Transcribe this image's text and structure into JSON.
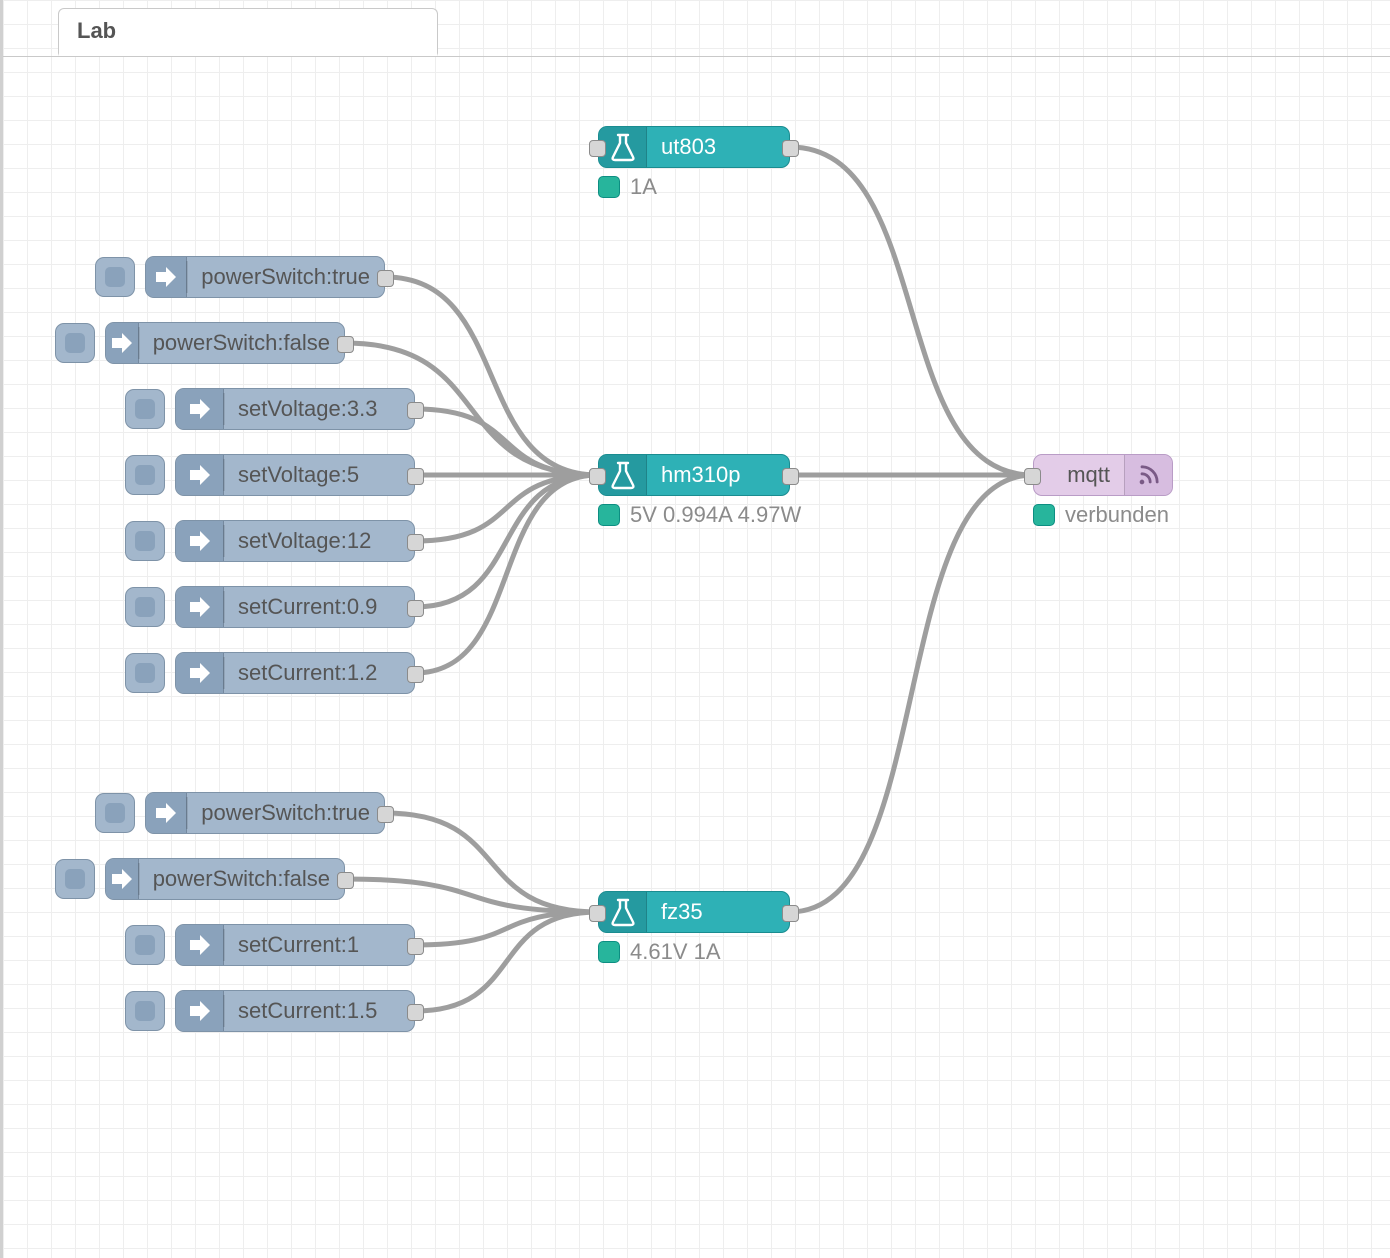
{
  "tab": {
    "label": "Lab"
  },
  "injectNodes": {
    "a": [
      {
        "id": "a0",
        "label": "powerSwitch:true"
      },
      {
        "id": "a1",
        "label": "powerSwitch:false"
      },
      {
        "id": "a2",
        "label": "setVoltage:3.3"
      },
      {
        "id": "a3",
        "label": "setVoltage:5"
      },
      {
        "id": "a4",
        "label": "setVoltage:12"
      },
      {
        "id": "a5",
        "label": "setCurrent:0.9"
      },
      {
        "id": "a6",
        "label": "setCurrent:1.2"
      }
    ],
    "b": [
      {
        "id": "b0",
        "label": "powerSwitch:true"
      },
      {
        "id": "b1",
        "label": "powerSwitch:false"
      },
      {
        "id": "b2",
        "label": "setCurrent:1"
      },
      {
        "id": "b3",
        "label": "setCurrent:1.5"
      }
    ]
  },
  "labNodes": {
    "ut803": {
      "label": "ut803",
      "status": "1A"
    },
    "hm310p": {
      "label": "hm310p",
      "status": "5V 0.994A 4.97W"
    },
    "fz35": {
      "label": "fz35",
      "status": "4.61V 1A"
    }
  },
  "mqtt": {
    "label": "mqtt",
    "status": "verbunden"
  },
  "colors": {
    "inject": "#a3b7cc",
    "lab": "#2eb1b6",
    "mqtt": "#e3cce8",
    "wire": "#9e9e9e",
    "statusDot": "#27b59c"
  }
}
